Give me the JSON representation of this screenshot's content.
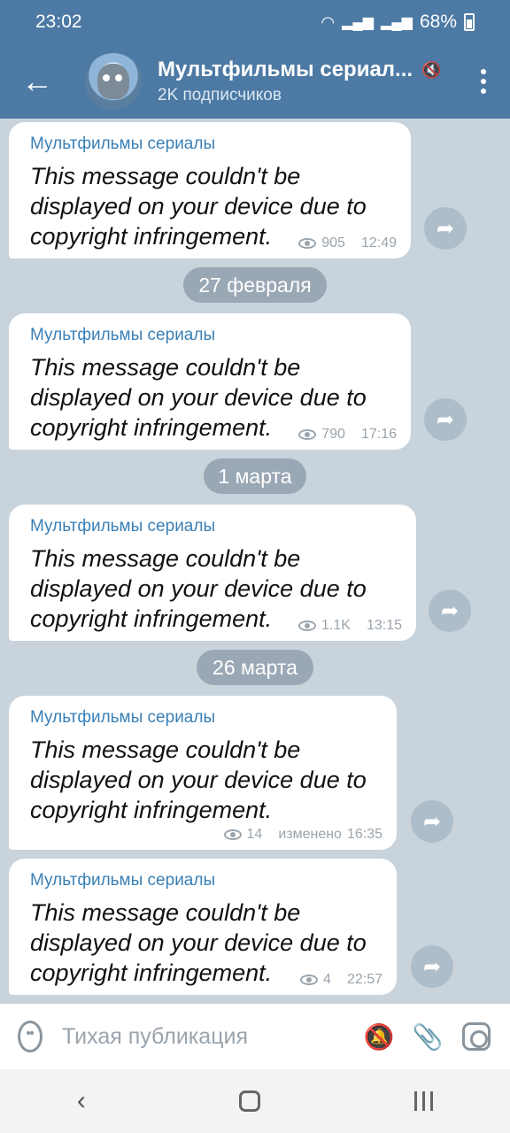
{
  "status_bar": {
    "time": "23:02",
    "battery": "68%",
    "icons": [
      "wifi-icon",
      "signal-icon",
      "signal-icon",
      "battery-icon"
    ]
  },
  "header": {
    "back_icon": "arrow-left-icon",
    "title": "Мультфильмы сериал...",
    "subtitle": "2K подписчиков",
    "mute_icon": "muted-icon",
    "menu_icon": "more-vertical-icon"
  },
  "messages": [
    {
      "sender": "Мультфильмы сериалы",
      "text": "This message couldn't be displayed on your device due to copyright infringement.",
      "views": "905",
      "time": "12:49",
      "edited": ""
    },
    {
      "sender": "Мультфильмы сериалы",
      "text": "This message couldn't be displayed on your device due to copyright infringement.",
      "views": "790",
      "time": "17:16",
      "edited": ""
    },
    {
      "sender": "Мультфильмы сериалы",
      "text": "This message couldn't be displayed on your device due to copyright infringement.",
      "views": "1.1K",
      "time": "13:15",
      "edited": ""
    },
    {
      "sender": "Мультфильмы сериалы",
      "text": "This message couldn't be displayed on your device due to copyright infringement.",
      "views": "14",
      "time": "16:35",
      "edited": "изменено"
    },
    {
      "sender": "Мультфильмы сериалы",
      "text": "This message couldn't be displayed on your device due to copyright infringement.",
      "views": "4",
      "time": "22:57",
      "edited": ""
    }
  ],
  "date_separators": [
    "27 февраля",
    "1 марта",
    "26 марта"
  ],
  "input_bar": {
    "placeholder": "Тихая публикация",
    "icons": [
      "emoji-icon",
      "bell-off-icon",
      "paperclip-icon",
      "camera-icon"
    ]
  },
  "nav_bar": {
    "icons": [
      "back-chevron-icon",
      "home-icon",
      "recents-icon"
    ]
  }
}
